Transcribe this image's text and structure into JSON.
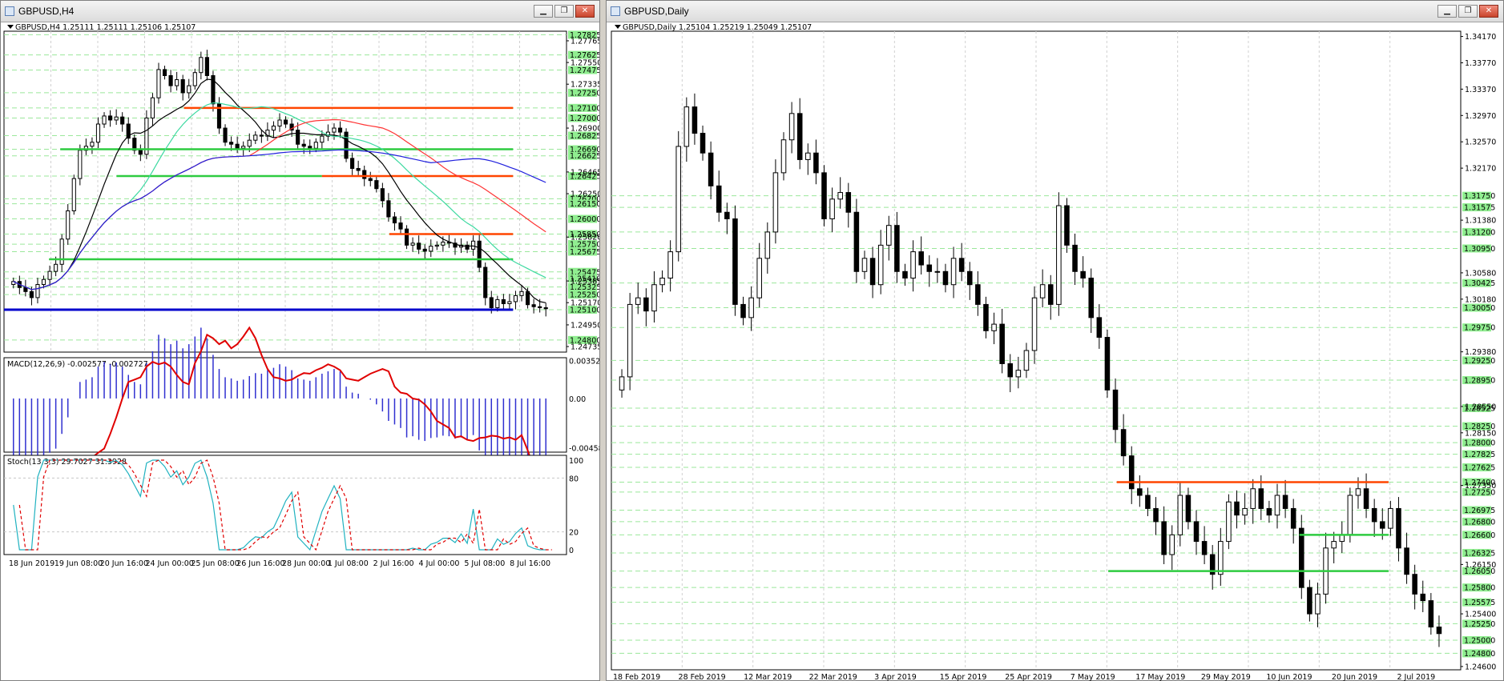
{
  "windows": [
    {
      "title": "GBPUSD,H4",
      "buttons": [
        "▁",
        "❐",
        "✕"
      ]
    },
    {
      "title": "GBPUSD,Daily",
      "buttons": [
        "▁",
        "❐",
        "✕"
      ]
    }
  ],
  "colors": {
    "bull": "#ffffff",
    "bear": "#000000",
    "grid": "#c8c8c8",
    "hline_green": "#2ecc40",
    "hline_red": "#ff4500",
    "hline_blue": "#0000cc",
    "label_green_bg": "#90ee90"
  },
  "chart_data": [
    {
      "type": "candlestick",
      "symbol": "GBPUSD",
      "timeframe": "H4",
      "header": "GBPUSD,H4  1.25111 1.25111 1.25106 1.25107",
      "ylim": [
        1.2468,
        1.2786
      ],
      "price_ticks": [
        "1.27765",
        "1.27550",
        "1.27335",
        "1.26900",
        "1.26465",
        "1.26250",
        "1.25820",
        "1.25385",
        "1.25170",
        "1.24950",
        "1.24735"
      ],
      "level_labels": [
        "1.27825",
        "1.27625",
        "1.27475",
        "1.27250",
        "1.27100",
        "1.27000",
        "1.26825",
        "1.26690",
        "1.26625",
        "1.26425",
        "1.26200",
        "1.26150",
        "1.26000",
        "1.25850",
        "1.25750",
        "1.25675",
        "1.25475",
        "1.25410",
        "1.25325",
        "1.25250",
        "1.25100",
        "1.24800"
      ],
      "x_labels": [
        "18 Jun 2019",
        "19 Jun 08:00",
        "20 Jun 16:00",
        "24 Jun 00:00",
        "25 Jun 08:00",
        "26 Jun 16:00",
        "28 Jun 00:00",
        "1 Jul 08:00",
        "2 Jul 16:00",
        "4 Jul 00:00",
        "5 Jul 08:00",
        "8 Jul 16:00"
      ],
      "closes": [
        1.2538,
        1.2532,
        1.2528,
        1.2522,
        1.2535,
        1.254,
        1.2548,
        1.2555,
        1.258,
        1.2608,
        1.264,
        1.2668,
        1.2672,
        1.2676,
        1.2694,
        1.2702,
        1.2698,
        1.2701,
        1.2694,
        1.268,
        1.2668,
        1.2664,
        1.27,
        1.272,
        1.2748,
        1.2742,
        1.2732,
        1.2738,
        1.2725,
        1.2732,
        1.2745,
        1.276,
        1.2742,
        1.2714,
        1.269,
        1.2676,
        1.2674,
        1.267,
        1.2672,
        1.2678,
        1.2683,
        1.2682,
        1.2688,
        1.2692,
        1.2698,
        1.2694,
        1.2688,
        1.2674,
        1.2672,
        1.267,
        1.2676,
        1.2682,
        1.2686,
        1.269,
        1.2686,
        1.266,
        1.265,
        1.2648,
        1.264,
        1.2638,
        1.263,
        1.2618,
        1.2602,
        1.2596,
        1.259,
        1.2574,
        1.2576,
        1.257,
        1.2568,
        1.2573,
        1.2574,
        1.2577,
        1.2576,
        1.2572,
        1.2574,
        1.257,
        1.2578,
        1.2552,
        1.2522,
        1.2512,
        1.252,
        1.2516,
        1.2518,
        1.2524,
        1.2528,
        1.2515,
        1.2513,
        1.2512,
        1.2511
      ],
      "h_lines": [
        {
          "price": 1.271,
          "color": "red",
          "from": 0.32,
          "to": 0.905
        },
        {
          "price": 1.2669,
          "color": "green",
          "from": 0.1,
          "to": 0.905
        },
        {
          "price": 1.26425,
          "color": "red",
          "from": 0.565,
          "to": 0.905
        },
        {
          "price": 1.26425,
          "color": "green",
          "from": 0.2,
          "to": 0.565
        },
        {
          "price": 1.2585,
          "color": "red",
          "from": 0.685,
          "to": 0.905
        },
        {
          "price": 1.256,
          "color": "green",
          "from": 0.08,
          "to": 0.905
        },
        {
          "price": 1.251,
          "color": "blue",
          "from": 0.0,
          "to": 0.905
        }
      ],
      "macd": {
        "label": "MACD(12,26,9) -0.002577 -0.002727",
        "ticks": [
          "0.003524",
          "0.00",
          "-0.00458"
        ],
        "ylim": [
          -0.005,
          0.0038
        ]
      },
      "stoch": {
        "label": "Stoch(13,3,3) 29.7027 31.3928",
        "ticks": [
          "100",
          "80",
          "20",
          "0"
        ]
      }
    },
    {
      "type": "candlestick",
      "symbol": "GBPUSD",
      "timeframe": "Daily",
      "header": "GBPUSD,Daily  1.25104 1.25219 1.25049 1.25107",
      "ylim": [
        1.2455,
        1.3425
      ],
      "price_ticks": [
        "1.34170",
        "1.33770",
        "1.33370",
        "1.32970",
        "1.32570",
        "1.32170",
        "1.31380",
        "1.30580",
        "1.30180",
        "1.29380",
        "1.28550",
        "1.28150",
        "1.27350",
        "1.26150",
        "1.25400",
        "1.24600"
      ],
      "level_labels": [
        "1.31750",
        "1.31575",
        "1.31200",
        "1.30950",
        "1.30425",
        "1.30050",
        "1.29750",
        "1.29250",
        "1.28950",
        "1.28525",
        "1.28250",
        "1.28000",
        "1.27825",
        "1.27625",
        "1.27400",
        "1.27250",
        "1.26975",
        "1.26800",
        "1.26600",
        "1.26325",
        "1.26050",
        "1.25800",
        "1.25575",
        "1.25250",
        "1.25000",
        "1.24800"
      ],
      "x_labels": [
        "18 Feb 2019",
        "28 Feb 2019",
        "12 Mar 2019",
        "22 Mar 2019",
        "3 Apr 2019",
        "15 Apr 2019",
        "25 Apr 2019",
        "7 May 2019",
        "17 May 2019",
        "29 May 2019",
        "10 Jun 2019",
        "20 Jun 2019",
        "2 Jul 2019"
      ],
      "closes": [
        1.29,
        1.301,
        1.302,
        1.3,
        1.304,
        1.305,
        1.309,
        1.325,
        1.331,
        1.327,
        1.324,
        1.319,
        1.315,
        1.314,
        1.301,
        1.299,
        1.302,
        1.308,
        1.312,
        1.321,
        1.326,
        1.33,
        1.323,
        1.324,
        1.321,
        1.314,
        1.317,
        1.318,
        1.315,
        1.306,
        1.308,
        1.304,
        1.31,
        1.313,
        1.306,
        1.305,
        1.309,
        1.307,
        1.306,
        1.306,
        1.304,
        1.308,
        1.306,
        1.304,
        1.301,
        1.297,
        1.298,
        1.292,
        1.29,
        1.291,
        1.294,
        1.302,
        1.304,
        1.301,
        1.316,
        1.31,
        1.306,
        1.305,
        1.299,
        1.296,
        1.288,
        1.282,
        1.278,
        1.273,
        1.272,
        1.27,
        1.268,
        1.263,
        1.266,
        1.272,
        1.268,
        1.265,
        1.263,
        1.26,
        1.265,
        1.271,
        1.269,
        1.27,
        1.273,
        1.27,
        1.269,
        1.272,
        1.27,
        1.267,
        1.258,
        1.254,
        1.257,
        1.264,
        1.265,
        1.266,
        1.272,
        1.273,
        1.27,
        1.268,
        1.267,
        1.27,
        1.264,
        1.26,
        1.257,
        1.256,
        1.252,
        1.251
      ],
      "h_lines": [
        {
          "price": 1.274,
          "color": "red",
          "from": 0.595,
          "to": 0.915
        },
        {
          "price": 1.266,
          "color": "green",
          "from": 0.81,
          "to": 0.915
        },
        {
          "price": 1.2605,
          "color": "green",
          "from": 0.585,
          "to": 0.915
        }
      ]
    }
  ]
}
